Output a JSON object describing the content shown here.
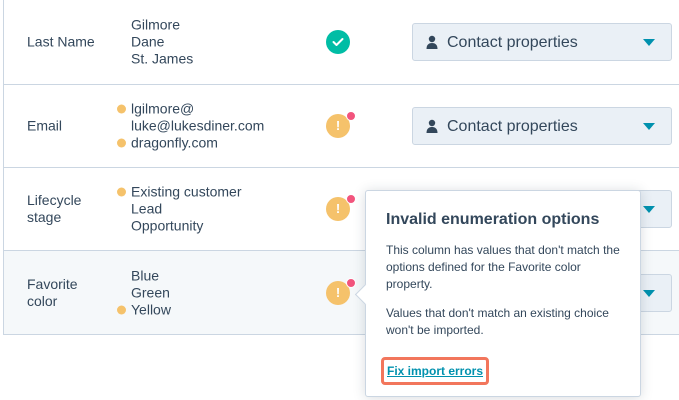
{
  "rows": [
    {
      "label": "Last Name",
      "values": [
        {
          "text": "Gilmore",
          "warning": false
        },
        {
          "text": "Dane",
          "warning": false
        },
        {
          "text": "St. James",
          "warning": false
        }
      ],
      "status": "success",
      "dropdown": "Contact properties"
    },
    {
      "label": "Email",
      "values": [
        {
          "text": "lgilmore@",
          "warning": true
        },
        {
          "text": "luke@lukesdiner.com",
          "warning": false
        },
        {
          "text": "dragonfly.com",
          "warning": true
        }
      ],
      "status": "error",
      "dropdown": "Contact properties"
    },
    {
      "label": "Lifecycle stage",
      "values": [
        {
          "text": "Existing customer",
          "warning": true
        },
        {
          "text": "Lead",
          "warning": false
        },
        {
          "text": "Opportunity",
          "warning": false
        }
      ],
      "status": "error",
      "dropdown": ""
    },
    {
      "label": "Favorite color",
      "values": [
        {
          "text": "Blue",
          "warning": false
        },
        {
          "text": "Green",
          "warning": false
        },
        {
          "text": "Yellow",
          "warning": true
        }
      ],
      "status": "error",
      "dropdown": ""
    }
  ],
  "popover": {
    "title": "Invalid enumeration options",
    "body1": "This column has values that don't match the options defined for the Favorite color property.",
    "body2": "Values that don't match an existing choice won't be imported.",
    "link": "Fix import errors"
  },
  "colors": {
    "success": "#00bda5",
    "warning": "#f5c26b",
    "alert_pip": "#f2547d",
    "link": "#0091ae",
    "highlight_outline": "#f2765c"
  },
  "icons": {
    "success": "check-circle-icon",
    "error": "exclamation-circle-icon",
    "dropdown": "contact-person-icon",
    "caret": "caret-down-icon"
  }
}
